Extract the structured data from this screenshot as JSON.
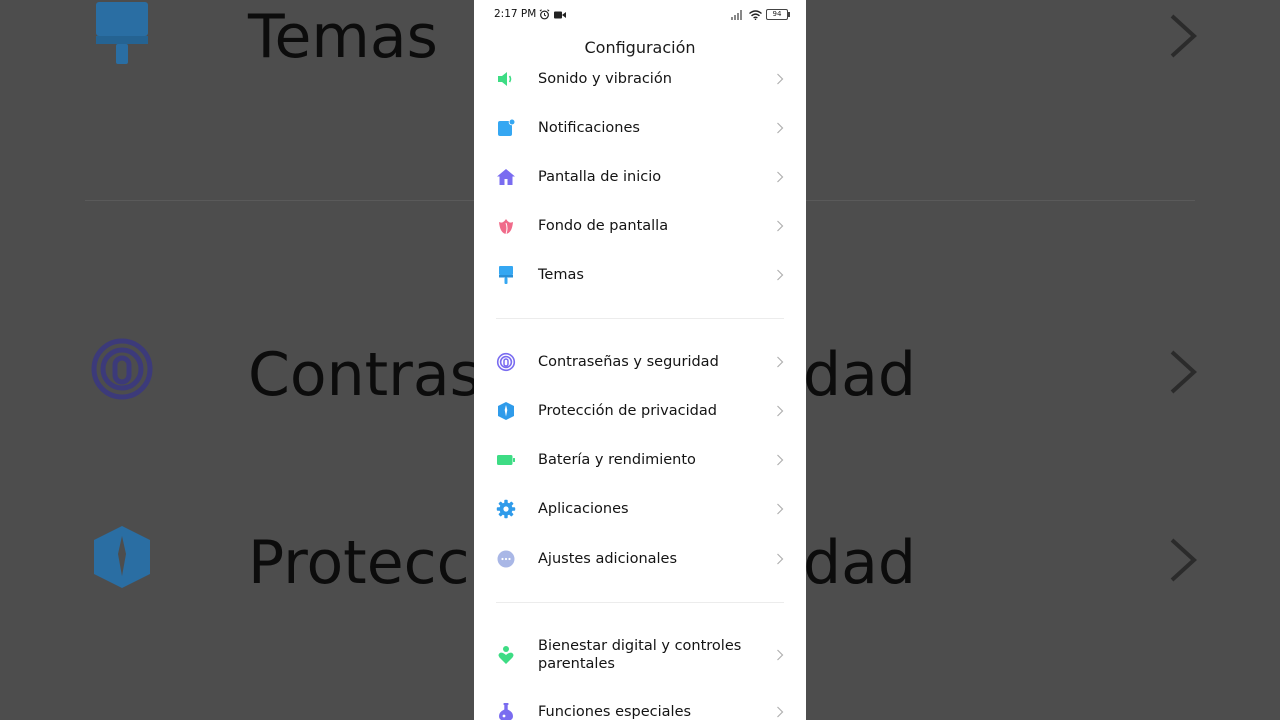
{
  "status_bar": {
    "time": "2:17 PM",
    "battery": "94"
  },
  "header": {
    "title": "Configuración"
  },
  "settings": {
    "group1": [
      {
        "label": "Sonido y vibración",
        "icon": "speaker-icon",
        "color": "#3ddc84"
      },
      {
        "label": "Notificaciones",
        "icon": "notification-icon",
        "color": "#35a7f2"
      },
      {
        "label": "Pantalla de inicio",
        "icon": "home-icon",
        "color": "#7a6cf0"
      },
      {
        "label": "Fondo de pantalla",
        "icon": "tulip-icon",
        "color": "#f06b8a"
      },
      {
        "label": "Temas",
        "icon": "paintbrush-icon",
        "color": "#2f9bea"
      }
    ],
    "group2": [
      {
        "label": "Contraseñas y seguridad",
        "icon": "fingerprint-icon",
        "color": "#6f5fd6"
      },
      {
        "label": "Protección de privacidad",
        "icon": "shield-icon",
        "color": "#2f9bea"
      },
      {
        "label": "Batería y rendimiento",
        "icon": "battery-icon",
        "color": "#3ddc84"
      },
      {
        "label": "Aplicaciones",
        "icon": "gear-icon",
        "color": "#2f9bea"
      },
      {
        "label": "Ajustes adicionales",
        "icon": "more-icon",
        "color": "#a9b7e6"
      }
    ],
    "group3": [
      {
        "label": "Bienestar digital y controles parentales",
        "icon": "wellbeing-icon",
        "color": "#3ddc84"
      },
      {
        "label": "Funciones especiales",
        "icon": "flask-icon",
        "color": "#7a6cf0"
      }
    ]
  },
  "background": {
    "items": [
      "Temas",
      "Contraseñas y seguridad",
      "Protección de privacidad"
    ]
  }
}
